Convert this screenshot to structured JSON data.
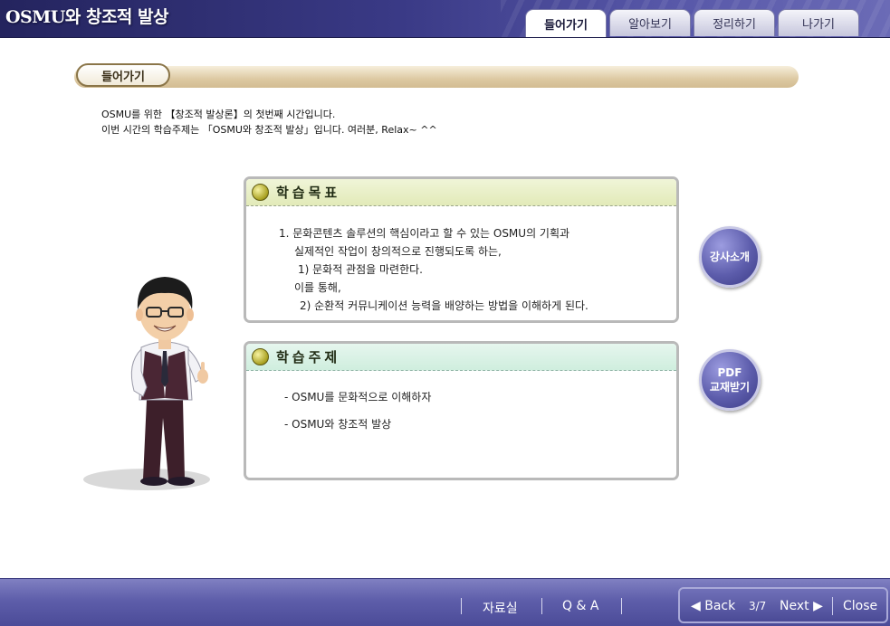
{
  "app": {
    "title": "OSMU와 창조적 발상"
  },
  "tabs": [
    {
      "label": "들어가기",
      "active": true
    },
    {
      "label": "알아보기",
      "active": false
    },
    {
      "label": "정리하기",
      "active": false
    },
    {
      "label": "나가기",
      "active": false
    }
  ],
  "section": {
    "label": "들어가기"
  },
  "intro": {
    "line1": "OSMU를 위한 【창조적 발상론】의 첫번째 시간입니다.",
    "line2": "이번 시간의 학습주제는 「OSMU와 창조적 발상」입니다. 여러분, Relax~ ^^"
  },
  "goals": {
    "title": "학습목표",
    "lines": [
      "1. 문화콘텐츠 솔루션의 핵심이라고 할 수 있는 OSMU의 기획과",
      "실제적인 작업이 창의적으로 진행되도록 하는,",
      "1) 문화적 관점을 마련한다.",
      "이를 통해,",
      "2) 순환적 커뮤니케이션 능력을 배양하는 방법을 이해하게 된다."
    ]
  },
  "topics": {
    "title": "학습주제",
    "items": [
      "- OSMU를 문화적으로 이해하자",
      "- OSMU와 창조적 발상"
    ]
  },
  "buttons": {
    "instructor": "강사소개",
    "pdf_line1": "PDF",
    "pdf_line2": "교재받기"
  },
  "footer": {
    "resources": "자료실",
    "qa": "Q & A",
    "back": "◀ Back",
    "page": "3/7",
    "next": "Next ▶",
    "close": "Close"
  },
  "colors": {
    "header": "#3a3a86",
    "footer": "#5e5eaa",
    "section_bar": "#ddc9a2",
    "goals_head": "#e2eab8",
    "topics_head": "#cfeede"
  }
}
